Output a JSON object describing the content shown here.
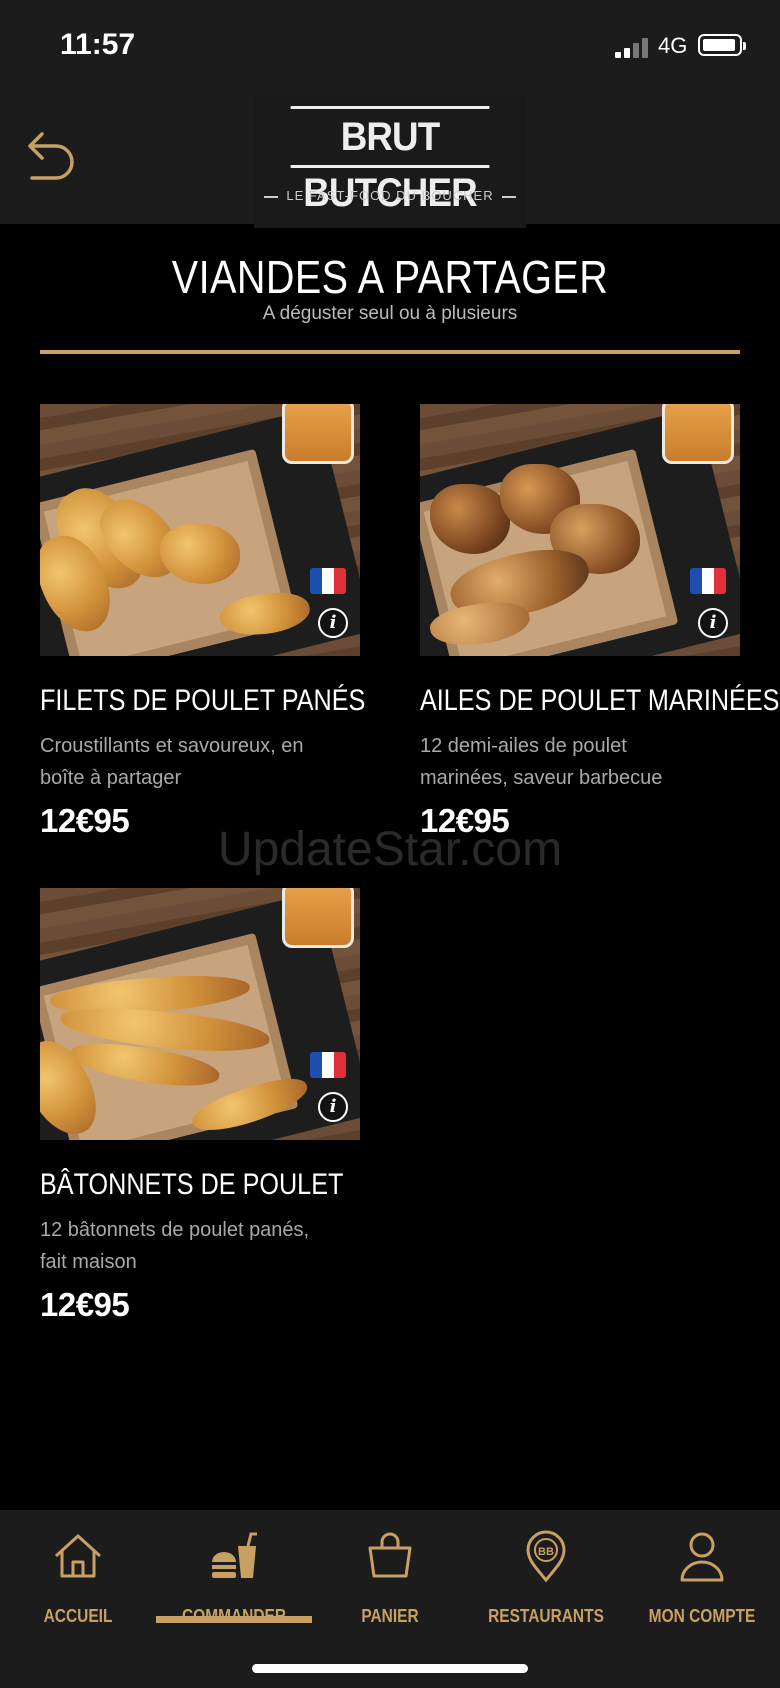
{
  "status_bar": {
    "time": "11:57",
    "network": "4G"
  },
  "header": {
    "brand": "BRUT BUTCHER",
    "tagline": "LE FAST-FOOD DU BOUCHER"
  },
  "section": {
    "title": "VIANDES A PARTAGER",
    "subtitle": "A déguster seul ou à plusieurs"
  },
  "products": [
    {
      "name": "FILETS DE POULET PANÉS",
      "desc_line1": "Croustillants et savoureux, en",
      "desc_line2": "boîte à partager",
      "price": "12€95"
    },
    {
      "name": "AILES DE POULET MARINÉES",
      "desc_line1": "12 demi-ailes de poulet",
      "desc_line2": "marinées, saveur barbecue",
      "price": "12€95"
    },
    {
      "name": "BÂTONNETS DE POULET",
      "desc_line1": "12 bâtonnets de poulet panés,",
      "desc_line2": "fait maison",
      "price": "12€95"
    }
  ],
  "info_glyph": "i",
  "watermark": "UpdateStar.com",
  "tabs": [
    {
      "label": "ACCUEIL",
      "icon": "home-icon"
    },
    {
      "label": "COMMANDER",
      "icon": "food-order-icon",
      "active": true
    },
    {
      "label": "PANIER",
      "icon": "basket-icon"
    },
    {
      "label": "RESTAURANTS",
      "icon": "location-pin-icon"
    },
    {
      "label": "MON COMPTE",
      "icon": "user-icon"
    }
  ],
  "colors": {
    "accent": "#c9a063",
    "background": "#000000",
    "bar": "#1c1c1c"
  }
}
